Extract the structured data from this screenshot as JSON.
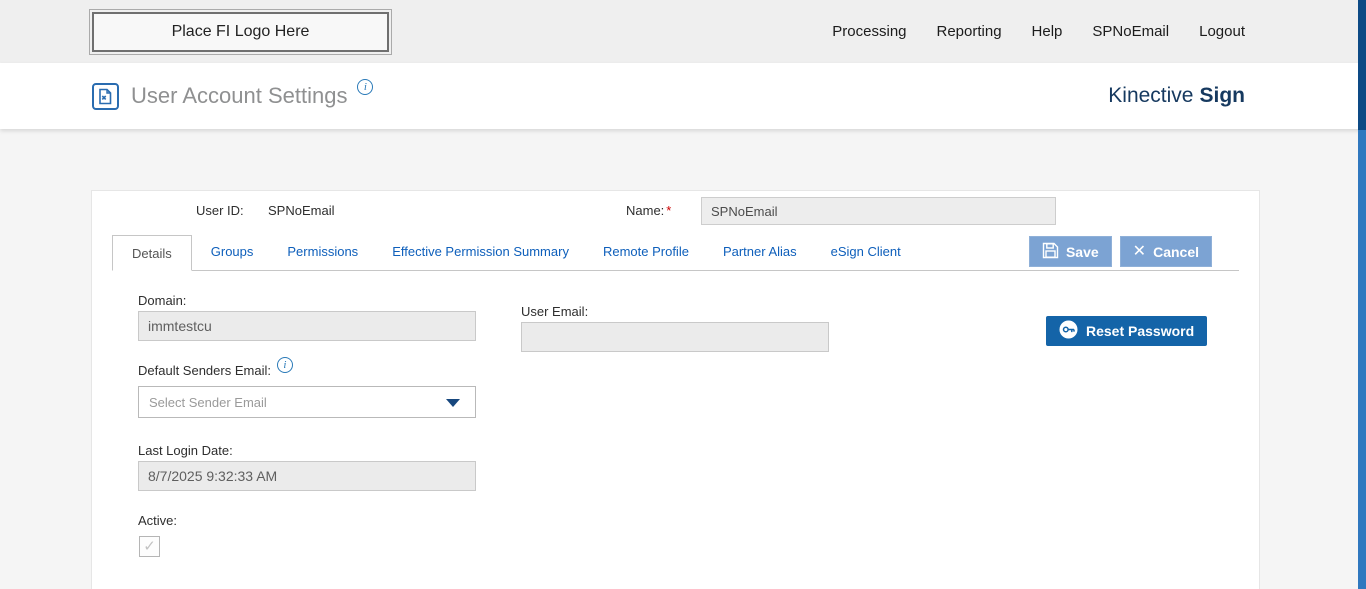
{
  "topbar": {
    "logo_text": "Place FI Logo Here",
    "nav": [
      {
        "label": "Processing"
      },
      {
        "label": "Reporting"
      },
      {
        "label": "Help"
      },
      {
        "label": "SPNoEmail"
      },
      {
        "label": "Logout"
      }
    ]
  },
  "header": {
    "title": "User Account Settings",
    "brand": {
      "regular": "Kinective",
      "bold": "Sign"
    }
  },
  "account": {
    "user_id_label": "User ID:",
    "user_id_value": "SPNoEmail",
    "name_label": "Name:",
    "required_marker": "*",
    "name_value": "SPNoEmail"
  },
  "tabs": [
    {
      "label": "Details",
      "active": true
    },
    {
      "label": "Groups"
    },
    {
      "label": "Permissions"
    },
    {
      "label": "Effective Permission Summary"
    },
    {
      "label": "Remote Profile"
    },
    {
      "label": "Partner Alias"
    },
    {
      "label": "eSign Client"
    }
  ],
  "actions": {
    "save_label": "Save",
    "cancel_label": "Cancel",
    "reset_password_label": "Reset Password"
  },
  "fields": {
    "domain": {
      "label": "Domain:",
      "value": "immtestcu"
    },
    "user_email": {
      "label": "User Email:",
      "value": ""
    },
    "default_senders_email": {
      "label": "Default Senders Email:",
      "placeholder": "Select Sender Email"
    },
    "last_login_date": {
      "label": "Last Login Date:",
      "value": "8/7/2025 9:32:33 AM"
    },
    "active": {
      "label": "Active:",
      "checked": true
    }
  },
  "icons": {
    "info": "i",
    "check": "✓",
    "cancel_x": "✕"
  },
  "colors": {
    "topbar_bg": "#efefef",
    "brand_navy": "#16395f",
    "link_blue": "#0e5fbb",
    "tab_button_blue": "#7ca3d3",
    "reset_button_blue": "#1464a8",
    "readonly_field_bg": "#ebebeb",
    "scrollbar_track": "#2f78bf",
    "scrollbar_thumb": "#0d4a85",
    "required_red": "#cc0000"
  }
}
